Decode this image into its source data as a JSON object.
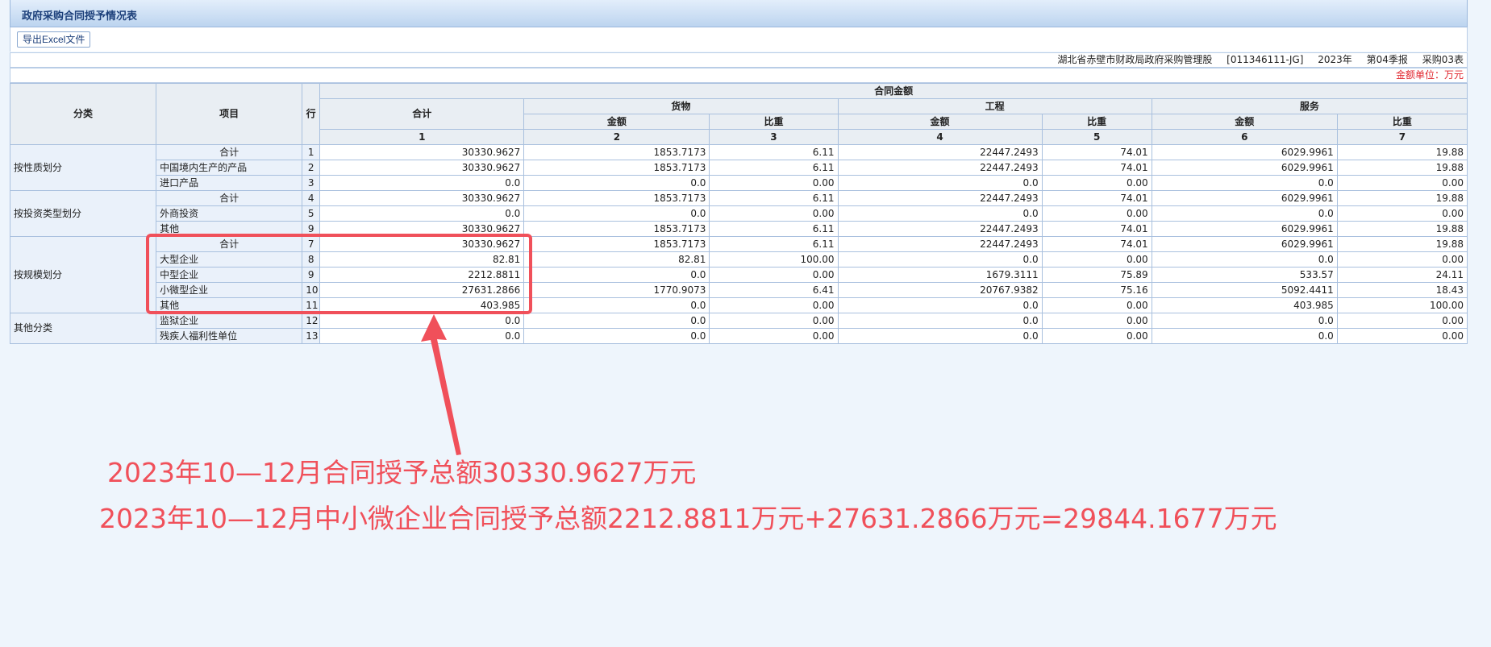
{
  "window": {
    "title": "政府采购合同授予情况表"
  },
  "toolbar": {
    "export_label": "导出Excel文件"
  },
  "meta": {
    "org": "湖北省赤壁市财政局政府采购管理股",
    "code": "[011346111-JG]",
    "year": "2023年",
    "period": "第04季报",
    "form": "采购03表",
    "unit": "金额单位：万元"
  },
  "table": {
    "headers": {
      "category": "分类",
      "item": "项目",
      "row": "行",
      "contract_amount": "合同金额",
      "total": "合计",
      "goods": "货物",
      "engineering": "工程",
      "services": "服务",
      "amount": "金额",
      "ratio": "比重",
      "col_numbers": [
        "1",
        "2",
        "3",
        "4",
        "5",
        "6",
        "7"
      ]
    },
    "groups": [
      {
        "category": "按性质划分",
        "rows": [
          {
            "item": "合计",
            "row": "1",
            "values": [
              "30330.9627",
              "1853.7173",
              "6.11",
              "22447.2493",
              "74.01",
              "6029.9961",
              "19.88"
            ]
          },
          {
            "item": "中国境内生产的产品",
            "row": "2",
            "values": [
              "30330.9627",
              "1853.7173",
              "6.11",
              "22447.2493",
              "74.01",
              "6029.9961",
              "19.88"
            ]
          },
          {
            "item": "进口产品",
            "row": "3",
            "values": [
              "0.0",
              "0.0",
              "0.00",
              "0.0",
              "0.00",
              "0.0",
              "0.00"
            ]
          }
        ]
      },
      {
        "category": "按投资类型划分",
        "rows": [
          {
            "item": "合计",
            "row": "4",
            "values": [
              "30330.9627",
              "1853.7173",
              "6.11",
              "22447.2493",
              "74.01",
              "6029.9961",
              "19.88"
            ]
          },
          {
            "item": "外商投资",
            "row": "5",
            "values": [
              "0.0",
              "0.0",
              "0.00",
              "0.0",
              "0.00",
              "0.0",
              "0.00"
            ]
          },
          {
            "item": "其他",
            "row": "9",
            "values": [
              "30330.9627",
              "1853.7173",
              "6.11",
              "22447.2493",
              "74.01",
              "6029.9961",
              "19.88"
            ]
          }
        ]
      },
      {
        "category": "按规模划分",
        "rows": [
          {
            "item": "合计",
            "row": "7",
            "values": [
              "30330.9627",
              "1853.7173",
              "6.11",
              "22447.2493",
              "74.01",
              "6029.9961",
              "19.88"
            ]
          },
          {
            "item": "大型企业",
            "row": "8",
            "values": [
              "82.81",
              "82.81",
              "100.00",
              "0.0",
              "0.00",
              "0.0",
              "0.00"
            ]
          },
          {
            "item": "中型企业",
            "row": "9",
            "values": [
              "2212.8811",
              "0.0",
              "0.00",
              "1679.3111",
              "75.89",
              "533.57",
              "24.11"
            ]
          },
          {
            "item": "小微型企业",
            "row": "10",
            "values": [
              "27631.2866",
              "1770.9073",
              "6.41",
              "20767.9382",
              "75.16",
              "5092.4411",
              "18.43"
            ]
          },
          {
            "item": "其他",
            "row": "11",
            "values": [
              "403.985",
              "0.0",
              "0.00",
              "0.0",
              "0.00",
              "403.985",
              "100.00"
            ]
          }
        ]
      },
      {
        "category": "其他分类",
        "rows": [
          {
            "item": "监狱企业",
            "row": "12",
            "values": [
              "0.0",
              "0.0",
              "0.00",
              "0.0",
              "0.00",
              "0.0",
              "0.00"
            ]
          },
          {
            "item": "残疾人福利性单位",
            "row": "13",
            "values": [
              "0.0",
              "0.0",
              "0.00",
              "0.0",
              "0.00",
              "0.0",
              "0.00"
            ]
          }
        ]
      }
    ]
  },
  "annotation": {
    "color": "#f0505a",
    "line1": "2023年10—12月合同授予总额30330.9627万元",
    "line2": "2023年10—12月中小微企业合同授予总额2212.8811万元+27631.2866万元=29844.1677万元"
  }
}
